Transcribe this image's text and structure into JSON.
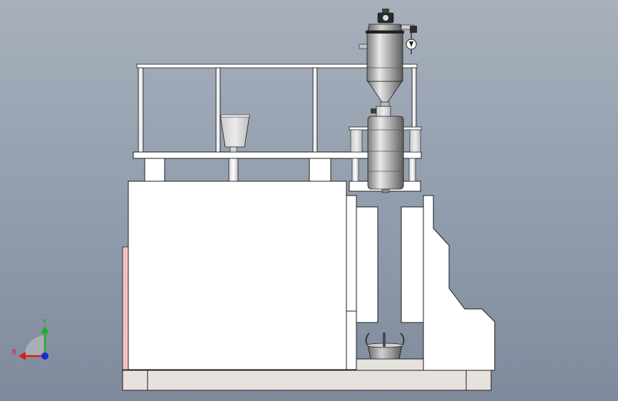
{
  "viewport": {
    "background_top": "#a8b0bb",
    "background_bottom": "#7f8b9c"
  },
  "triad": {
    "x_label": "X",
    "y_label": "Y",
    "x_color": "#d81e1e",
    "y_color": "#1fae2a",
    "z_color": "#1a2ccf"
  },
  "colors": {
    "body_fill": "#ffffff",
    "edge": "#1c1c1c",
    "base_fill": "#e6e2de",
    "pink_panel": "#f2c2c2",
    "metal_light": "#e2e2e2",
    "metal_mid": "#a8a8a8",
    "metal_dark": "#6e6e6e"
  }
}
